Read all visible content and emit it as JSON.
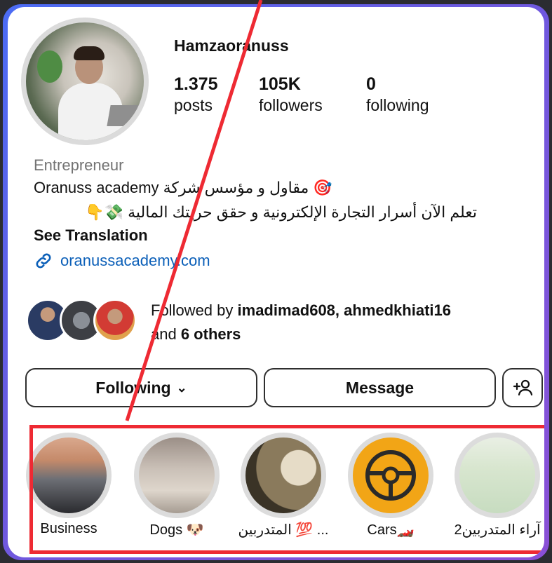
{
  "profile": {
    "username": "Hamzaoranuss",
    "stats": [
      {
        "value": "1.375",
        "label": "posts"
      },
      {
        "value": "105K",
        "label": "followers"
      },
      {
        "value": "0",
        "label": "following"
      }
    ],
    "category": "Entrepreneur",
    "bio_line1": "Oranuss academy مقاول و مؤسس شركة 🎯",
    "bio_line2": "تعلم الآن أسرار التجارة الإلكترونية و حقق حريتك المالية 💸👇",
    "see_translation": "See Translation",
    "link": "oranussacademy.com",
    "followed_by_prefix": "Followed by ",
    "followed_by_names": "imadimad608, ahmedkhiati16",
    "followed_by_and": "and ",
    "followed_by_others": "6 others"
  },
  "actions": {
    "following_label": "Following",
    "message_label": "Message",
    "add_user_icon": "+person"
  },
  "highlights": [
    {
      "label": "Business"
    },
    {
      "label": "Dogs 🐶"
    },
    {
      "label": "المتدربين 💯 ..."
    },
    {
      "label": "Cars🏎️"
    },
    {
      "label": "آراء المتدربين2"
    }
  ],
  "colors": {
    "accent_link": "#0b5fb8",
    "highlight_box": "#ee2a33",
    "frame_gradient_start": "#4b6cf5",
    "frame_gradient_end": "#8a4fd6"
  }
}
